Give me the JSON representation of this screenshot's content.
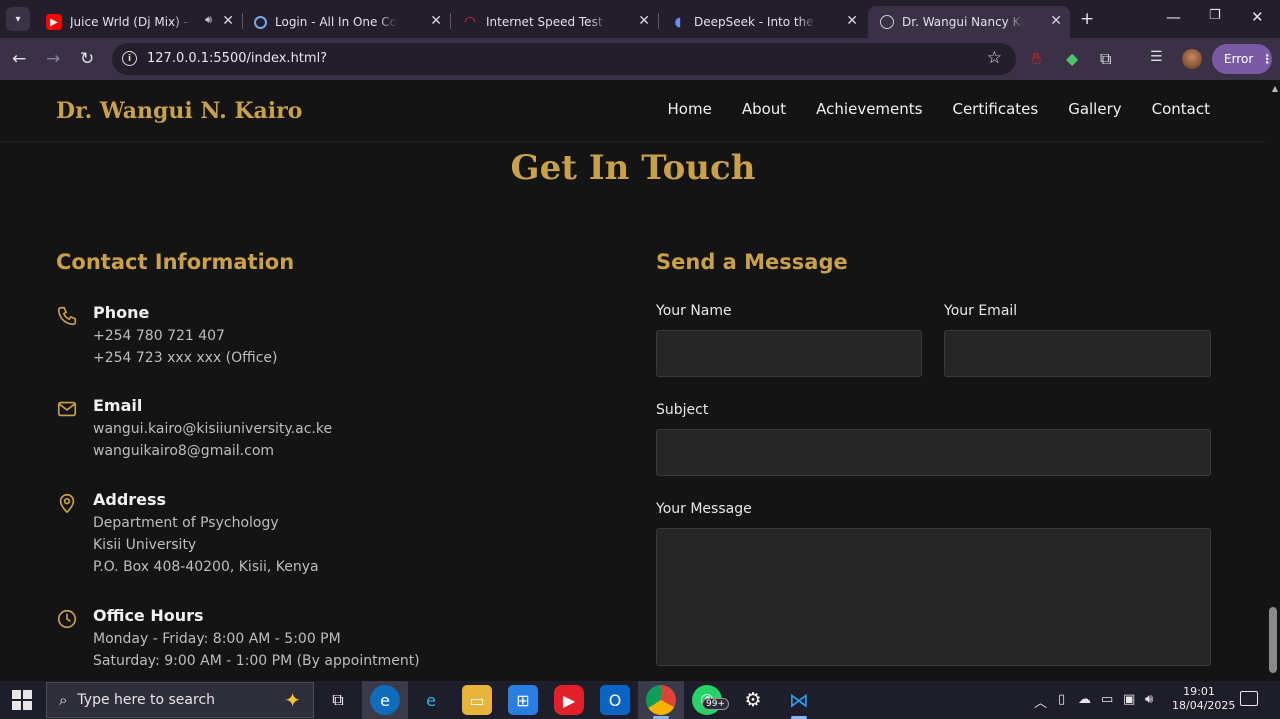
{
  "browser": {
    "tabs": [
      {
        "title": "Juice Wrld (Dj Mix) - YouTube",
        "favicon": "youtube-icon"
      },
      {
        "title": "Login - All In One Comrade",
        "favicon": "loading-icon"
      },
      {
        "title": "Internet Speed Test | Fast.com",
        "favicon": "speedometer-icon"
      },
      {
        "title": "DeepSeek - Into the Unknown",
        "favicon": "deepseek-icon"
      },
      {
        "title": "Dr. Wangui Nancy Kairo | Contact",
        "favicon": "globe-icon"
      }
    ],
    "url": "127.0.0.1:5500/index.html?",
    "error_label": "Error"
  },
  "site": {
    "brand": "Dr. Wangui N. Kairo",
    "nav": [
      "Home",
      "About",
      "Achievements",
      "Certificates",
      "Gallery",
      "Contact"
    ],
    "heading": "Get In Touch",
    "contact_heading": "Contact Information",
    "phone": {
      "title": "Phone",
      "lines": [
        "+254 780 721 407",
        "+254 723 xxx xxx (Office)"
      ]
    },
    "email": {
      "title": "Email",
      "lines": [
        "wangui.kairo@kisiiuniversity.ac.ke",
        "wanguikairo8@gmail.com"
      ]
    },
    "address": {
      "title": "Address",
      "lines": [
        "Department of Psychology",
        "Kisii University",
        "P.O. Box 408-40200, Kisii, Kenya"
      ]
    },
    "hours": {
      "title": "Office Hours",
      "lines": [
        "Monday - Friday: 8:00 AM - 5:00 PM",
        "Saturday: 9:00 AM - 1:00 PM (By appointment)"
      ]
    },
    "form": {
      "heading": "Send a Message",
      "name_label": "Your Name",
      "email_label": "Your Email",
      "subject_label": "Subject",
      "message_label": "Your Message"
    },
    "accent": "#c9a14a"
  },
  "taskbar": {
    "search_placeholder": "Type here to search",
    "badge": "99+",
    "time": "19:01",
    "date": "18/04/2025"
  }
}
